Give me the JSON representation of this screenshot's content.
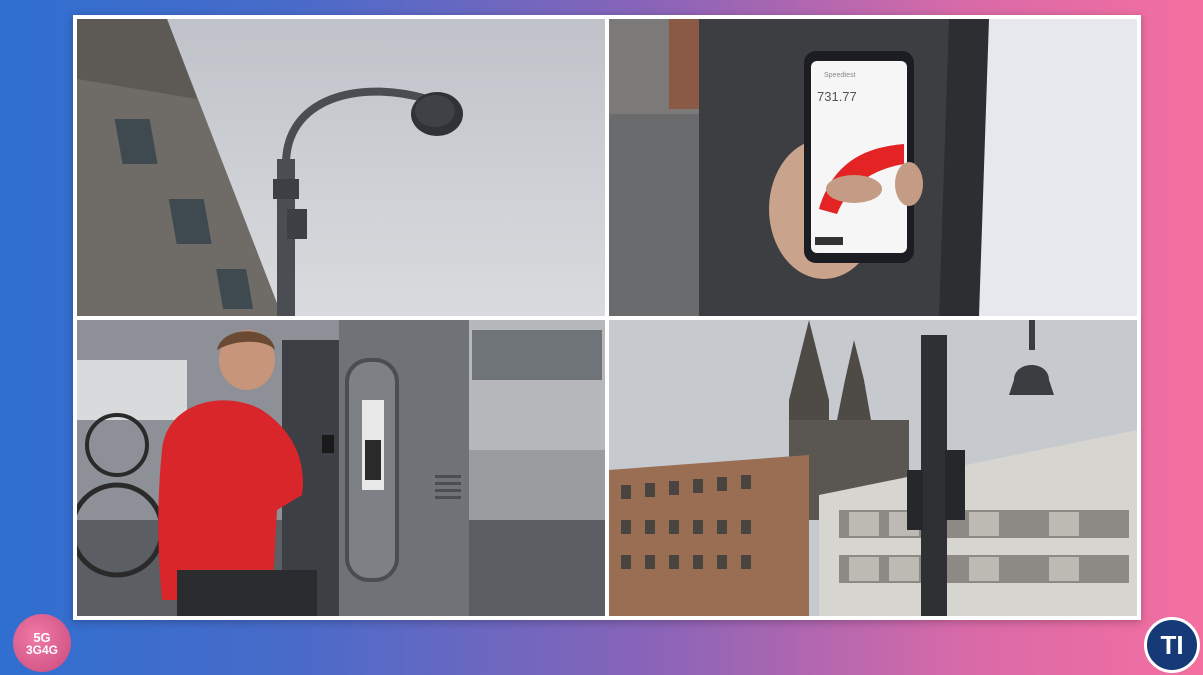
{
  "badges": {
    "left_line1": "5G",
    "left_line2": "3G4G",
    "right": "TI"
  },
  "phone": {
    "app_name": "Speedtest",
    "speed_value": "731.77"
  },
  "colors": {
    "jacket_red": "#d8262a",
    "sky": "#c9ccd1",
    "pole": "#4a4d52",
    "badge_left": "#e0628f",
    "badge_right": "#163a78"
  }
}
